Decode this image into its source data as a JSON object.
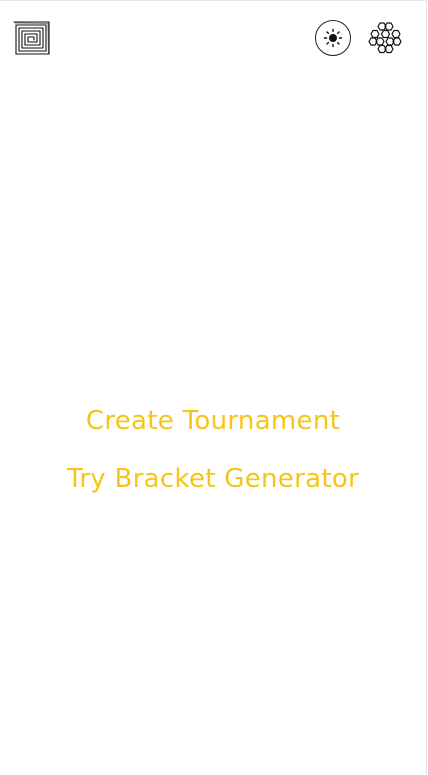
{
  "header": {
    "logo_icon": "spiral-maze-logo-icon",
    "theme_toggle_icon": "sun-icon",
    "settings_icon": "honeycomb-icon"
  },
  "menu": {
    "items": [
      {
        "label": "Create Tournament"
      },
      {
        "label": "Try Bracket Generator"
      }
    ],
    "link_color": "#f5c518"
  }
}
